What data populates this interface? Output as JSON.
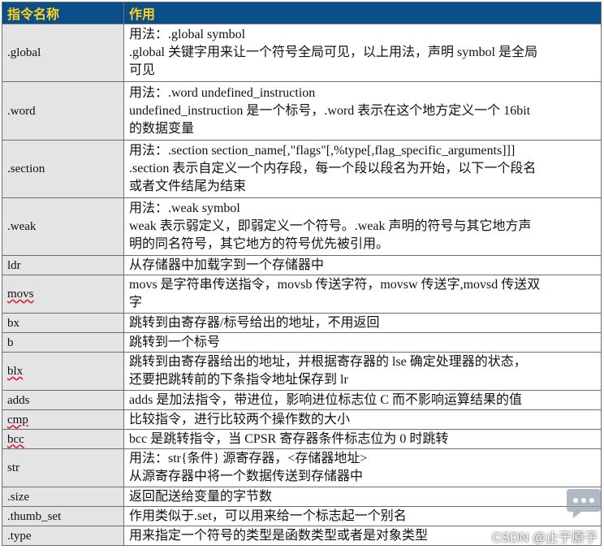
{
  "header": {
    "col1": "指令名称",
    "col2": "作用"
  },
  "rows": [
    {
      "cmd": ".global",
      "desc": [
        "用法：.global symbol",
        ".global 关键字用来让一个符号全局可见，以上用法，声明 symbol 是全局",
        "可见"
      ]
    },
    {
      "cmd": ".word",
      "desc": [
        "用法：.word    undefined_instruction",
        "undefined_instruction 是一个标号，.word 表示在这个地方定义一个 16bit",
        "的数据变量"
      ]
    },
    {
      "cmd": ".section",
      "desc": [
        "用法：.section section_name[,\"flags\"[,%type[,flag_specific_arguments]]]",
        ".section 表示自定义一个内存段，每一个段以段名为开始，以下一个段名",
        "或者文件结尾为结束"
      ]
    },
    {
      "cmd": ".weak",
      "desc": [
        "用法：.weak symbol",
        "weak 表示弱定义，即弱定义一个符号。.weak 声明的符号与其它地方声",
        "明的同名符号，其它地方的符号优先被引用。"
      ]
    },
    {
      "cmd": "ldr",
      "desc": [
        "从存储器中加载字到一个存储器中"
      ]
    },
    {
      "cmd": "movs",
      "desc": [
        "movs 是字符串传送指令，movsb 传送字符，movsw 传送字,movsd 传送双",
        "字"
      ]
    },
    {
      "cmd": "bx",
      "desc": [
        "跳转到由寄存器/标号给出的地址，不用返回"
      ]
    },
    {
      "cmd": "b",
      "desc": [
        "跳转到一个标号"
      ]
    },
    {
      "cmd": "blx",
      "desc": [
        "跳转到由寄存器给出的地址，并根据寄存器的 lse 确定处理器的状态，",
        "还要把跳转前的下条指令地址保存到 lr"
      ]
    },
    {
      "cmd": "adds",
      "desc": [
        "adds 是加法指令，带进位，影响进位标志位 C 而不影响运算结果的值"
      ]
    },
    {
      "cmd": "cmp",
      "desc": [
        "比较指令，进行比较两个操作数的大小"
      ]
    },
    {
      "cmd": "bcc",
      "desc": [
        "bcc 是跳转指令，当 CPSR 寄存器条件标志位为 0 时跳转"
      ]
    },
    {
      "cmd": "str",
      "desc": [
        "用法：str{条件}  源寄存器，<存储器地址>",
        "从源寄存器中将一个数据传送到存储器中"
      ]
    },
    {
      "cmd": ".size",
      "desc": [
        " 返回配送给变量的字节数"
      ]
    },
    {
      "cmd": ".thumb_set",
      "desc": [
        "作用类似于.set，可以用来给一个标志起一个别名"
      ]
    },
    {
      "cmd": ".type",
      "desc": [
        "用来指定一个符号的类型是函数类型或者是对象类型"
      ]
    }
  ],
  "watermark": "CSDN @止于原子",
  "colors": {
    "header_bg": "#0b4f8a",
    "header_text": "#ffd21f",
    "cmd_bg": "#e4e4e4",
    "border": "#6e6e6e"
  }
}
